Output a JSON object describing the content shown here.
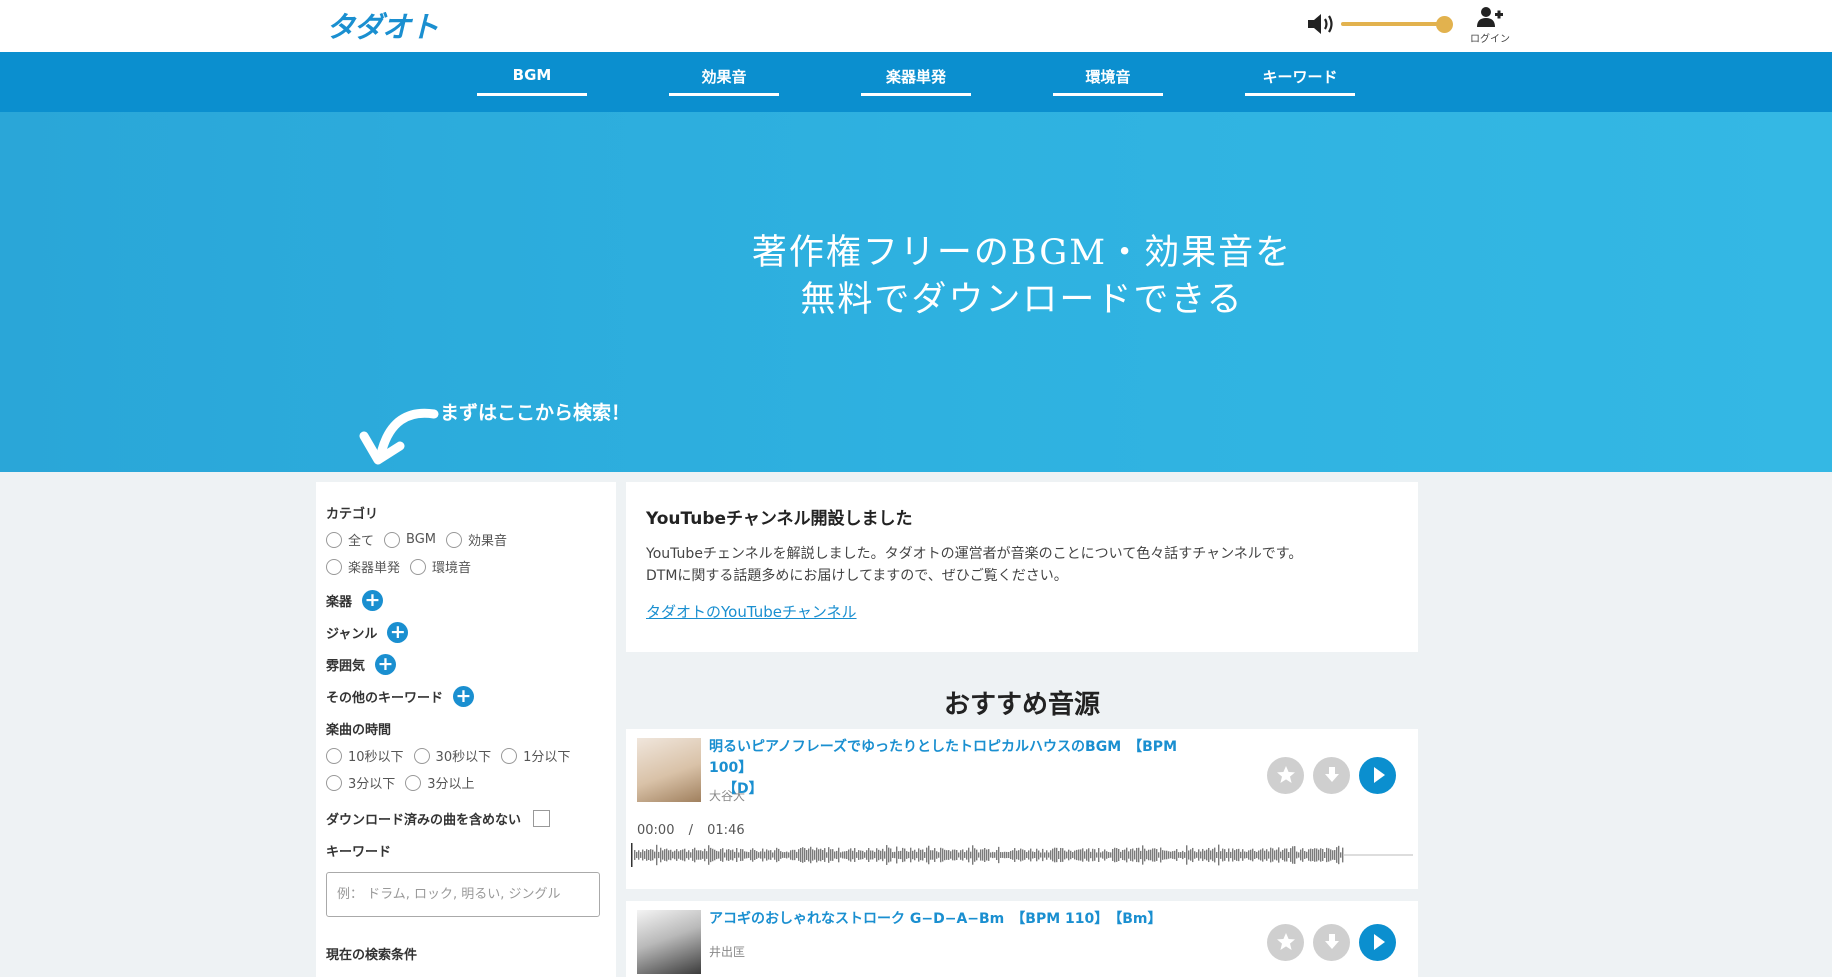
{
  "header": {
    "logo": "タダオト",
    "login_label": "ログイン",
    "volume_percent": 100,
    "colors": {
      "brand": "#1a8fd0",
      "volume": "#e2b24e"
    }
  },
  "nav": {
    "items": [
      {
        "label": "BGM"
      },
      {
        "label": "効果音"
      },
      {
        "label": "楽器単発"
      },
      {
        "label": "環境音"
      },
      {
        "label": "キーワード"
      }
    ]
  },
  "hero": {
    "line1": "著作権フリーのBGM・効果音を",
    "line2": "無料でダウンロードできる",
    "hint": "まずはここから検索！"
  },
  "sidebar": {
    "category_title": "カテゴリ",
    "categories": [
      "全て",
      "BGM",
      "効果音",
      "楽器単発",
      "環境音"
    ],
    "instrument_title": "楽器",
    "genre_title": "ジャンル",
    "mood_title": "雰囲気",
    "other_kw_title": "その他のキーワード",
    "duration_title": "楽曲の時間",
    "durations": [
      "10秒以下",
      "30秒以下",
      "1分以下",
      "3分以下",
      "3分以上"
    ],
    "exclude_downloaded": "ダウンロード済みの曲を含めない",
    "keyword_title": "キーワード",
    "keyword_placeholder": "例： ドラム, ロック, 明るい, ジングル",
    "current_conditions": "現在の検索条件"
  },
  "notice": {
    "title": "YouTubeチャンネル開設しました",
    "body_line1": "YouTubeチェンネルを解説しました。タダオトの運営者が音楽のことについて色々話すチャンネルです。",
    "body_line2": "DTMに関する話題多めにお届けしてますので、ぜひご覧ください。",
    "link": "タダオトのYouTubeチャンネル"
  },
  "recommended": {
    "title": "おすすめ音源",
    "tracks": [
      {
        "title_line1": "明るいピアノフレーズでゆったりとしたトロピカルハウスのBGM　【BPM 100】",
        "title_line2": "【D】",
        "artist": "大谷大",
        "current_time": "00:00",
        "separator": "/",
        "duration": "01:46"
      },
      {
        "title_line1": "アコギのおしゃれなストローク G−D−A−Bm　【BPM 110】　【Bm】",
        "title_line2": "",
        "artist": "井出匡"
      }
    ]
  }
}
